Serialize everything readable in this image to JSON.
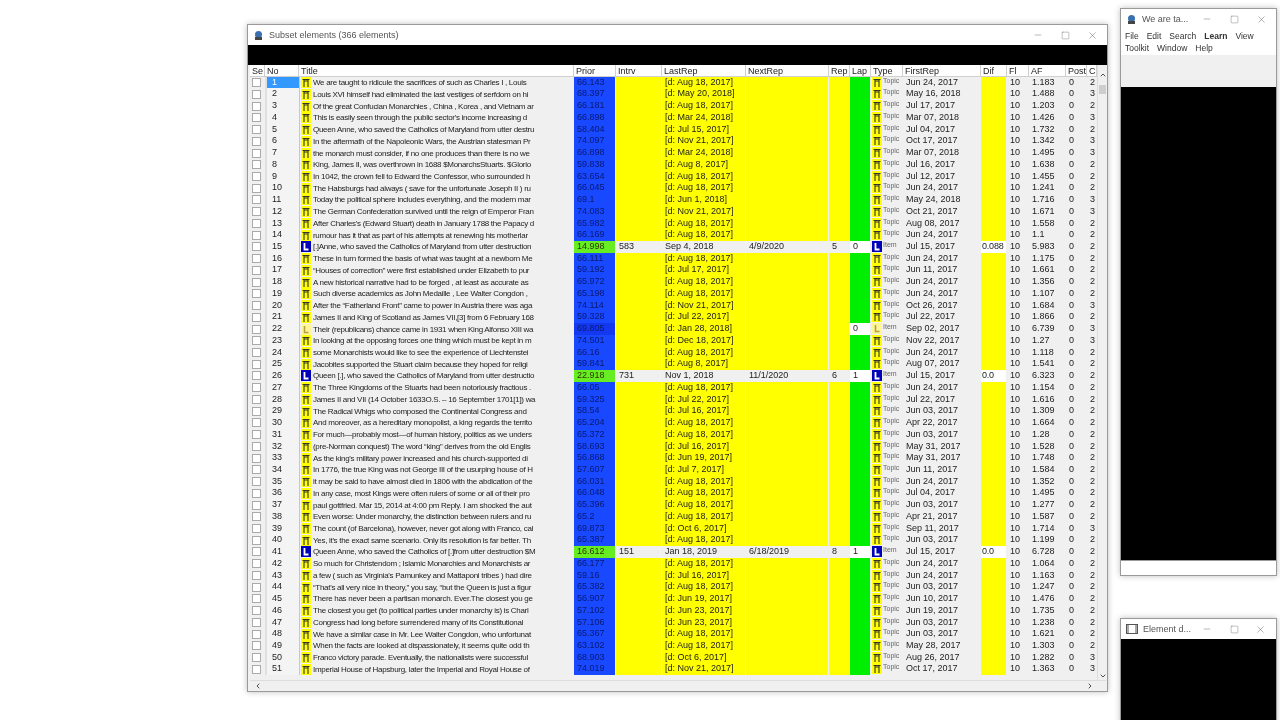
{
  "main_window": {
    "title": "Subset elements (366 elements)"
  },
  "table": {
    "columns": [
      "Se",
      "No",
      "Title",
      "Prior",
      "Intrv",
      "LastRep",
      "NextRep",
      "Rep",
      "Lap",
      "Type",
      "FirstRep",
      "Dif",
      "Fl",
      "AF",
      "Post",
      "C"
    ],
    "rows": [
      {
        "no": "1",
        "title": "We are taught to ridicule the sacrifices of such as Charles I , Louis",
        "kind": "topic",
        "type_label": "Topic",
        "prior": "66.143",
        "last_rep": "[d: Aug 18, 2017]",
        "first_rep": "Jun 24, 2017",
        "fl": "10",
        "af": "1.183",
        "post": "0",
        "c": "2",
        "checked": false,
        "selected": true
      },
      {
        "no": "2",
        "title": "Louis XVI himself had eliminated the last vestiges of serfdom on hi",
        "kind": "topic",
        "type_label": "Topic",
        "prior": "68.397",
        "last_rep": "[d: May 20, 2018]",
        "first_rep": "May 16, 2018",
        "fl": "10",
        "af": "1.488",
        "post": "0",
        "c": "3",
        "checked": false,
        "selected": false
      },
      {
        "no": "3",
        "title": "Of the great Confucian Monarchies , China , Korea , and Vietnam ar",
        "kind": "topic",
        "type_label": "Topic",
        "prior": "66.181",
        "last_rep": "[d: Aug 18, 2017]",
        "first_rep": "Jul 17, 2017",
        "fl": "10",
        "af": "1.203",
        "post": "0",
        "c": "2",
        "checked": false,
        "selected": false
      },
      {
        "no": "4",
        "title": "This is easily seen through the public sector's income increasing d",
        "kind": "topic",
        "type_label": "Topic",
        "prior": "66.898",
        "last_rep": "[d: Mar 24, 2018]",
        "first_rep": "Mar 07, 2018",
        "fl": "10",
        "af": "1.426",
        "post": "0",
        "c": "3",
        "checked": false,
        "selected": false
      },
      {
        "no": "5",
        "title": "Queen Anne, who saved the Catholics of Maryland from utter destru",
        "kind": "topic",
        "type_label": "Topic",
        "prior": "58.404",
        "last_rep": "[d: Jul 15, 2017]",
        "first_rep": "Jul 04, 2017",
        "fl": "10",
        "af": "1.732",
        "post": "0",
        "c": "2",
        "checked": false,
        "selected": false
      },
      {
        "no": "6",
        "title": "In the aftermath of the Napoleonic Wars, the Austrian statesman Pr",
        "kind": "topic",
        "type_label": "Topic",
        "prior": "74.097",
        "last_rep": "[d: Nov 21, 2017]",
        "first_rep": "Oct 17, 2017",
        "fl": "10",
        "af": "1.342",
        "post": "0",
        "c": "3",
        "checked": false,
        "selected": false
      },
      {
        "no": "7",
        "title": "the monarch must consider, if no one produces than there is no we",
        "kind": "topic",
        "type_label": "Topic",
        "prior": "66.898",
        "last_rep": "[d: Mar 24, 2018]",
        "first_rep": "Mar 07, 2018",
        "fl": "10",
        "af": "1.495",
        "post": "0",
        "c": "3",
        "checked": false,
        "selected": false
      },
      {
        "no": "8",
        "title": "King, James II, was overthrown in 1688 $MonarchsStuarts. $Glorio",
        "kind": "topic",
        "type_label": "Topic",
        "prior": "59.838",
        "last_rep": "[d: Aug 8, 2017]",
        "first_rep": "Jul 16, 2017",
        "fl": "10",
        "af": "1.638",
        "post": "0",
        "c": "2",
        "checked": false,
        "selected": false
      },
      {
        "no": "9",
        "title": "In 1042, the crown fell to Edward the Confessor, who surrounded h",
        "kind": "topic",
        "type_label": "Topic",
        "prior": "63.654",
        "last_rep": "[d: Aug 18, 2017]",
        "first_rep": "Jul 12, 2017",
        "fl": "10",
        "af": "1.455",
        "post": "0",
        "c": "2",
        "checked": false,
        "selected": false
      },
      {
        "no": "10",
        "title": "The Habsburgs had always ( save for the unfortunate Joseph II ) ru",
        "kind": "topic",
        "type_label": "Topic",
        "prior": "66.045",
        "last_rep": "[d: Aug 18, 2017]",
        "first_rep": "Jun 24, 2017",
        "fl": "10",
        "af": "1.241",
        "post": "0",
        "c": "2",
        "checked": false,
        "selected": false
      },
      {
        "no": "11",
        "title": "Today the political sphere includes everything, and the modern mar",
        "kind": "topic",
        "type_label": "Topic",
        "prior": "69.1",
        "last_rep": "[d: Jun 1, 2018]",
        "first_rep": "May 24, 2018",
        "fl": "10",
        "af": "1.716",
        "post": "0",
        "c": "3",
        "checked": false,
        "selected": false
      },
      {
        "no": "12",
        "title": "The German Confederation survived until the reign of Emperor Fran",
        "kind": "topic",
        "type_label": "Topic",
        "prior": "74.083",
        "last_rep": "[d: Nov 21, 2017]",
        "first_rep": "Oct 21, 2017",
        "fl": "10",
        "af": "1.671",
        "post": "0",
        "c": "3",
        "checked": false,
        "selected": false
      },
      {
        "no": "13",
        "title": "After Charles's (Edward Stuart) death in January 1788 the Papacy d",
        "kind": "topic",
        "type_label": "Topic",
        "prior": "65.982",
        "last_rep": "[d: Aug 18, 2017]",
        "first_rep": "Aug 08, 2017",
        "fl": "10",
        "af": "1.558",
        "post": "0",
        "c": "2",
        "checked": false,
        "selected": false
      },
      {
        "no": "14",
        "title": "rumour has it that as part of his attempts at renewing his motherlar",
        "kind": "topic",
        "type_label": "Topic",
        "prior": "66.169",
        "last_rep": "[d: Aug 18, 2017]",
        "first_rep": "Jun 24, 2017",
        "fl": "10",
        "af": "1.1",
        "post": "0",
        "c": "2",
        "checked": false,
        "selected": false
      },
      {
        "no": "15",
        "title": "[.]Anne, who saved the Catholics of Maryland from utter destruction",
        "kind": "item",
        "type_label": "Item",
        "prior": "14.998",
        "interval": "583",
        "last_rep": "Sep 4, 2018",
        "next_rep": "4/9/2020",
        "reps": "5",
        "lapses": "0",
        "first_rep": "Jul 15, 2017",
        "difficulty": "0.088",
        "fl": "10",
        "af": "5.983",
        "post": "0",
        "c": "2",
        "checked": false,
        "selected": false
      },
      {
        "no": "16",
        "title": "These in turn formed the basis of what was taught at a newborn Me",
        "kind": "topic",
        "type_label": "Topic",
        "prior": "66.111",
        "last_rep": "[d: Aug 18, 2017]",
        "first_rep": "Jun 24, 2017",
        "fl": "10",
        "af": "1.175",
        "post": "0",
        "c": "2",
        "checked": false,
        "selected": false
      },
      {
        "no": "17",
        "title": "“Houses of correction” were first established under Elizabeth to pur",
        "kind": "topic",
        "type_label": "Topic",
        "prior": "59.192",
        "last_rep": "[d: Jul 17, 2017]",
        "first_rep": "Jun 11, 2017",
        "fl": "10",
        "af": "1.661",
        "post": "0",
        "c": "2",
        "checked": false,
        "selected": false
      },
      {
        "no": "18",
        "title": "A new historical narrative had to be forged , at least as accurate as",
        "kind": "topic",
        "type_label": "Topic",
        "prior": "65.972",
        "last_rep": "[d: Aug 18, 2017]",
        "first_rep": "Jun 24, 2017",
        "fl": "10",
        "af": "1.356",
        "post": "0",
        "c": "2",
        "checked": false,
        "selected": false
      },
      {
        "no": "19",
        "title": "Such diverse academics as John Medaille , Lee Walter Congdon ,",
        "kind": "topic",
        "type_label": "Topic",
        "prior": "65.198",
        "last_rep": "[d: Aug 18, 2017]",
        "first_rep": "Jun 24, 2017",
        "fl": "10",
        "af": "1.107",
        "post": "0",
        "c": "2",
        "checked": false,
        "selected": false
      },
      {
        "no": "20",
        "title": "After the “Fatherland Front” came to power in Austria there was aga",
        "kind": "topic",
        "type_label": "Topic",
        "prior": "74.114",
        "last_rep": "[d: Nov 21, 2017]",
        "first_rep": "Oct 26, 2017",
        "fl": "10",
        "af": "1.684",
        "post": "0",
        "c": "3",
        "checked": false,
        "selected": false
      },
      {
        "no": "21",
        "title": "James II and King of Scotland as James VII,[3] from 6 February 168",
        "kind": "topic",
        "type_label": "Topic",
        "prior": "59.328",
        "last_rep": "[d: Jul 22, 2017]",
        "first_rep": "Jul 22, 2017",
        "fl": "10",
        "af": "1.866",
        "post": "0",
        "c": "2",
        "checked": false,
        "selected": false
      },
      {
        "no": "22",
        "title": "Their (republicans) chance came in 1931 when King Alfonso XIII wa",
        "kind": "dismissed",
        "type_label": "Item",
        "prior": "69.805",
        "last_rep": "[d: Jan 28, 2018]",
        "lapses": "0",
        "first_rep": "Sep 02, 2017",
        "fl": "10",
        "af": "6.739",
        "post": "0",
        "c": "3",
        "checked": false,
        "selected": false
      },
      {
        "no": "23",
        "title": "In looking at the opposing forces one thing which must be kept in m",
        "kind": "topic",
        "type_label": "Topic",
        "prior": "74.501",
        "last_rep": "[d: Dec 18, 2017]",
        "first_rep": "Nov 22, 2017",
        "fl": "10",
        "af": "1.27",
        "post": "0",
        "c": "3",
        "checked": false,
        "selected": false
      },
      {
        "no": "24",
        "title": "some Monarchists would like to see the experience of Liechtenstei",
        "kind": "topic",
        "type_label": "Topic",
        "prior": "66.16",
        "last_rep": "[d: Aug 18, 2017]",
        "first_rep": "Jun 24, 2017",
        "fl": "10",
        "af": "1.118",
        "post": "0",
        "c": "2",
        "checked": false,
        "selected": false
      },
      {
        "no": "25",
        "title": "Jacobites supported the Stuart claim because they hoped for religi",
        "kind": "topic",
        "type_label": "Topic",
        "prior": "59.841",
        "last_rep": "[d: Aug 8, 2017]",
        "first_rep": "Aug 07, 2017",
        "fl": "10",
        "af": "1.541",
        "post": "0",
        "c": "2",
        "checked": false,
        "selected": false
      },
      {
        "no": "26",
        "title": "Queen [.], who saved the Catholics of Maryland from utter destructio",
        "kind": "item",
        "type_label": "Item",
        "prior": "22.918",
        "interval": "731",
        "last_rep": "Nov 1, 2018",
        "next_rep": "11/1/2020",
        "reps": "6",
        "lapses": "1",
        "first_rep": "Jul 15, 2017",
        "difficulty": "0.0",
        "fl": "10",
        "af": "6.323",
        "post": "0",
        "c": "2",
        "checked": false,
        "selected": false
      },
      {
        "no": "27",
        "title": "The Three Kingdoms of the Stuarts had been notoriously fractious .",
        "kind": "topic",
        "type_label": "Topic",
        "prior": "66.05",
        "last_rep": "[d: Aug 18, 2017]",
        "first_rep": "Jun 24, 2017",
        "fl": "10",
        "af": "1.154",
        "post": "0",
        "c": "2",
        "checked": false,
        "selected": false
      },
      {
        "no": "28",
        "title": "James II and VII (14 October 1633O.S. – 16 September 1701[1]) wa",
        "kind": "topic",
        "type_label": "Topic",
        "prior": "59.325",
        "last_rep": "[d: Jul 22, 2017]",
        "first_rep": "Jul 22, 2017",
        "fl": "10",
        "af": "1.616",
        "post": "0",
        "c": "2",
        "checked": false,
        "selected": false
      },
      {
        "no": "29",
        "title": "The Radical Whigs who composed the Continental Congress and",
        "kind": "topic",
        "type_label": "Topic",
        "prior": "58.54",
        "last_rep": "[d: Jul 16, 2017]",
        "first_rep": "Jun 03, 2017",
        "fl": "10",
        "af": "1.309",
        "post": "0",
        "c": "2",
        "checked": false,
        "selected": false
      },
      {
        "no": "30",
        "title": "And moreover, as a hereditary monopolist, a king regards the territo",
        "kind": "topic",
        "type_label": "Topic",
        "prior": "65.204",
        "last_rep": "[d: Aug 18, 2017]",
        "first_rep": "Apr 22, 2017",
        "fl": "10",
        "af": "1.664",
        "post": "0",
        "c": "2",
        "checked": false,
        "selected": false
      },
      {
        "no": "31",
        "title": "For much—probably most—of human history, politics as we unders",
        "kind": "topic",
        "type_label": "Topic",
        "prior": "65.372",
        "last_rep": "[d: Aug 18, 2017]",
        "first_rep": "Jun 03, 2017",
        "fl": "10",
        "af": "1.28",
        "post": "0",
        "c": "2",
        "checked": false,
        "selected": false
      },
      {
        "no": "32",
        "title": "(pre-Norman conquest) The word “king” derives from the old Englis",
        "kind": "topic",
        "type_label": "Topic",
        "prior": "58.693",
        "last_rep": "[d: Jul 16, 2017]",
        "first_rep": "May 31, 2017",
        "fl": "10",
        "af": "1.528",
        "post": "0",
        "c": "2",
        "checked": false,
        "selected": false
      },
      {
        "no": "33",
        "title": "As the king's military power increased and his church-supported di",
        "kind": "topic",
        "type_label": "Topic",
        "prior": "56.868",
        "last_rep": "[d: Jun 19, 2017]",
        "first_rep": "May 31, 2017",
        "fl": "10",
        "af": "1.748",
        "post": "0",
        "c": "2",
        "checked": false,
        "selected": false
      },
      {
        "no": "34",
        "title": "In 1776, the true King was not George III of the usurping house of H",
        "kind": "topic",
        "type_label": "Topic",
        "prior": "57.607",
        "last_rep": "[d: Jul 7, 2017]",
        "first_rep": "Jun 11, 2017",
        "fl": "10",
        "af": "1.584",
        "post": "0",
        "c": "2",
        "checked": false,
        "selected": false
      },
      {
        "no": "35",
        "title": "it may be said to have almost died in 1806 with the abdication of the",
        "kind": "topic",
        "type_label": "Topic",
        "prior": "66.031",
        "last_rep": "[d: Aug 18, 2017]",
        "first_rep": "Jun 24, 2017",
        "fl": "10",
        "af": "1.352",
        "post": "0",
        "c": "2",
        "checked": false,
        "selected": false
      },
      {
        "no": "36",
        "title": "In any case, most Kings were often rulers of some or all of their pro",
        "kind": "topic",
        "type_label": "Topic",
        "prior": "66.048",
        "last_rep": "[d: Aug 18, 2017]",
        "first_rep": "Jul 04, 2017",
        "fl": "10",
        "af": "1.495",
        "post": "0",
        "c": "2",
        "checked": false,
        "selected": false
      },
      {
        "no": "37",
        "title": "paul gottfried. Mar 15, 2014 at 4:00 pm Reply. I am shocked the aut",
        "kind": "topic",
        "type_label": "Topic",
        "prior": "65.396",
        "last_rep": "[d: Aug 18, 2017]",
        "first_rep": "Jun 03, 2017",
        "fl": "10",
        "af": "1.277",
        "post": "0",
        "c": "2",
        "checked": false,
        "selected": false
      },
      {
        "no": "38",
        "title": "Even worse: Under monarchy, the distinction between rulers and ru",
        "kind": "topic",
        "type_label": "Topic",
        "prior": "65.2",
        "last_rep": "[d: Aug 18, 2017]",
        "first_rep": "Apr 21, 2017",
        "fl": "10",
        "af": "1.587",
        "post": "0",
        "c": "2",
        "checked": false,
        "selected": false
      },
      {
        "no": "39",
        "title": "The count (of Barcelona), however, never got along with Franco, cal",
        "kind": "topic",
        "type_label": "Topic",
        "prior": "69.873",
        "last_rep": "[d: Oct 6, 2017]",
        "first_rep": "Sep 11, 2017",
        "fl": "10",
        "af": "1.714",
        "post": "0",
        "c": "3",
        "checked": false,
        "selected": false
      },
      {
        "no": "40",
        "title": "Yes, it's the exact same scenario. Only its resolution is far better. Th",
        "kind": "topic",
        "type_label": "Topic",
        "prior": "65.387",
        "last_rep": "[d: Aug 18, 2017]",
        "first_rep": "Jun 03, 2017",
        "fl": "10",
        "af": "1.199",
        "post": "0",
        "c": "2",
        "checked": false,
        "selected": false
      },
      {
        "no": "41",
        "title": "Queen Anne, who saved the Catholics of [.]from utter destruction $M",
        "kind": "item",
        "type_label": "Item",
        "prior": "16.612",
        "interval": "151",
        "last_rep": "Jan 18, 2019",
        "next_rep": "6/18/2019",
        "reps": "8",
        "lapses": "1",
        "first_rep": "Jul 15, 2017",
        "difficulty": "0.0",
        "fl": "10",
        "af": "6.728",
        "post": "0",
        "c": "2",
        "checked": false,
        "selected": false
      },
      {
        "no": "42",
        "title": "So much for Christendom ; Islamic Monarchies and Monarchists ar",
        "kind": "topic",
        "type_label": "Topic",
        "prior": "66.177",
        "last_rep": "[d: Aug 18, 2017]",
        "first_rep": "Jun 24, 2017",
        "fl": "10",
        "af": "1.064",
        "post": "0",
        "c": "2",
        "checked": false,
        "selected": false
      },
      {
        "no": "43",
        "title": "a few ( such as Virginia's Pamunkey and Mattaponi tribes ) had dire",
        "kind": "topic",
        "type_label": "Topic",
        "prior": "59.16",
        "last_rep": "[d: Jul 16, 2017]",
        "first_rep": "Jun 24, 2017",
        "fl": "10",
        "af": "1.163",
        "post": "0",
        "c": "2",
        "checked": false,
        "selected": false
      },
      {
        "no": "44",
        "title": "“That's all very nice in theory,” you say, “but the Queen is just a figur",
        "kind": "topic",
        "type_label": "Topic",
        "prior": "65.382",
        "last_rep": "[d: Aug 18, 2017]",
        "first_rep": "Jun 03, 2017",
        "fl": "10",
        "af": "1.247",
        "post": "0",
        "c": "2",
        "checked": false,
        "selected": false
      },
      {
        "no": "45",
        "title": "There has never been a partisan monarch. Ever.The closest you ge",
        "kind": "topic",
        "type_label": "Topic",
        "prior": "56.907",
        "last_rep": "[d: Jun 19, 2017]",
        "first_rep": "Jun 10, 2017",
        "fl": "10",
        "af": "1.476",
        "post": "0",
        "c": "2",
        "checked": false,
        "selected": false
      },
      {
        "no": "46",
        "title": "The closest you get (to political parties under monarchy is) is Charl",
        "kind": "topic",
        "type_label": "Topic",
        "prior": "57.102",
        "last_rep": "[d: Jun 23, 2017]",
        "first_rep": "Jun 19, 2017",
        "fl": "10",
        "af": "1.735",
        "post": "0",
        "c": "2",
        "checked": false,
        "selected": false
      },
      {
        "no": "47",
        "title": "Congress had long before surrendered many of its Constitutional",
        "kind": "topic",
        "type_label": "Topic",
        "prior": "57.106",
        "last_rep": "[d: Jun 23, 2017]",
        "first_rep": "Jun 03, 2017",
        "fl": "10",
        "af": "1.238",
        "post": "0",
        "c": "2",
        "checked": false,
        "selected": false
      },
      {
        "no": "48",
        "title": "We have a similar case in Mr. Lee Walter Congdon, who unfortunat",
        "kind": "topic",
        "type_label": "Topic",
        "prior": "65.367",
        "last_rep": "[d: Aug 18, 2017]",
        "first_rep": "Jun 03, 2017",
        "fl": "10",
        "af": "1.621",
        "post": "0",
        "c": "2",
        "checked": false,
        "selected": false
      },
      {
        "no": "49",
        "title": "When the facts are looked at dispassionately, it seems quite odd th",
        "kind": "topic",
        "type_label": "Topic",
        "prior": "63.102",
        "last_rep": "[d: Aug 18, 2017]",
        "first_rep": "May 28, 2017",
        "fl": "10",
        "af": "1.303",
        "post": "0",
        "c": "2",
        "checked": false,
        "selected": false
      },
      {
        "no": "50",
        "title": "Franco victory parade. Eventually, the nationalists were successful",
        "kind": "topic",
        "type_label": "Topic",
        "prior": "68.903",
        "last_rep": "[d: Oct 6, 2017]",
        "first_rep": "Aug 26, 2017",
        "fl": "10",
        "af": "1.282",
        "post": "0",
        "c": "3",
        "checked": false,
        "selected": false
      },
      {
        "no": "51",
        "title": "Imperial House of Hapsburg, later the Imperial and Royal House of",
        "kind": "topic",
        "type_label": "Topic",
        "prior": "74.019",
        "last_rep": "[d: Nov 21, 2017]",
        "first_rep": "Oct 17, 2017",
        "fl": "10",
        "af": "1.363",
        "post": "0",
        "c": "3",
        "checked": false,
        "selected": false
      }
    ]
  },
  "side_window": {
    "title": "We are ta...",
    "menu_rows": [
      [
        {
          "label": "File",
          "bold": false
        },
        {
          "label": "Edit",
          "bold": false
        },
        {
          "label": "Search",
          "bold": false
        },
        {
          "label": "Learn",
          "bold": true
        },
        {
          "label": "View",
          "bold": false
        }
      ],
      [
        {
          "label": "Toolkit",
          "bold": false
        },
        {
          "label": "Window",
          "bold": false
        },
        {
          "label": "Help",
          "bold": false
        }
      ]
    ]
  },
  "element_window": {
    "title": "Element d..."
  }
}
